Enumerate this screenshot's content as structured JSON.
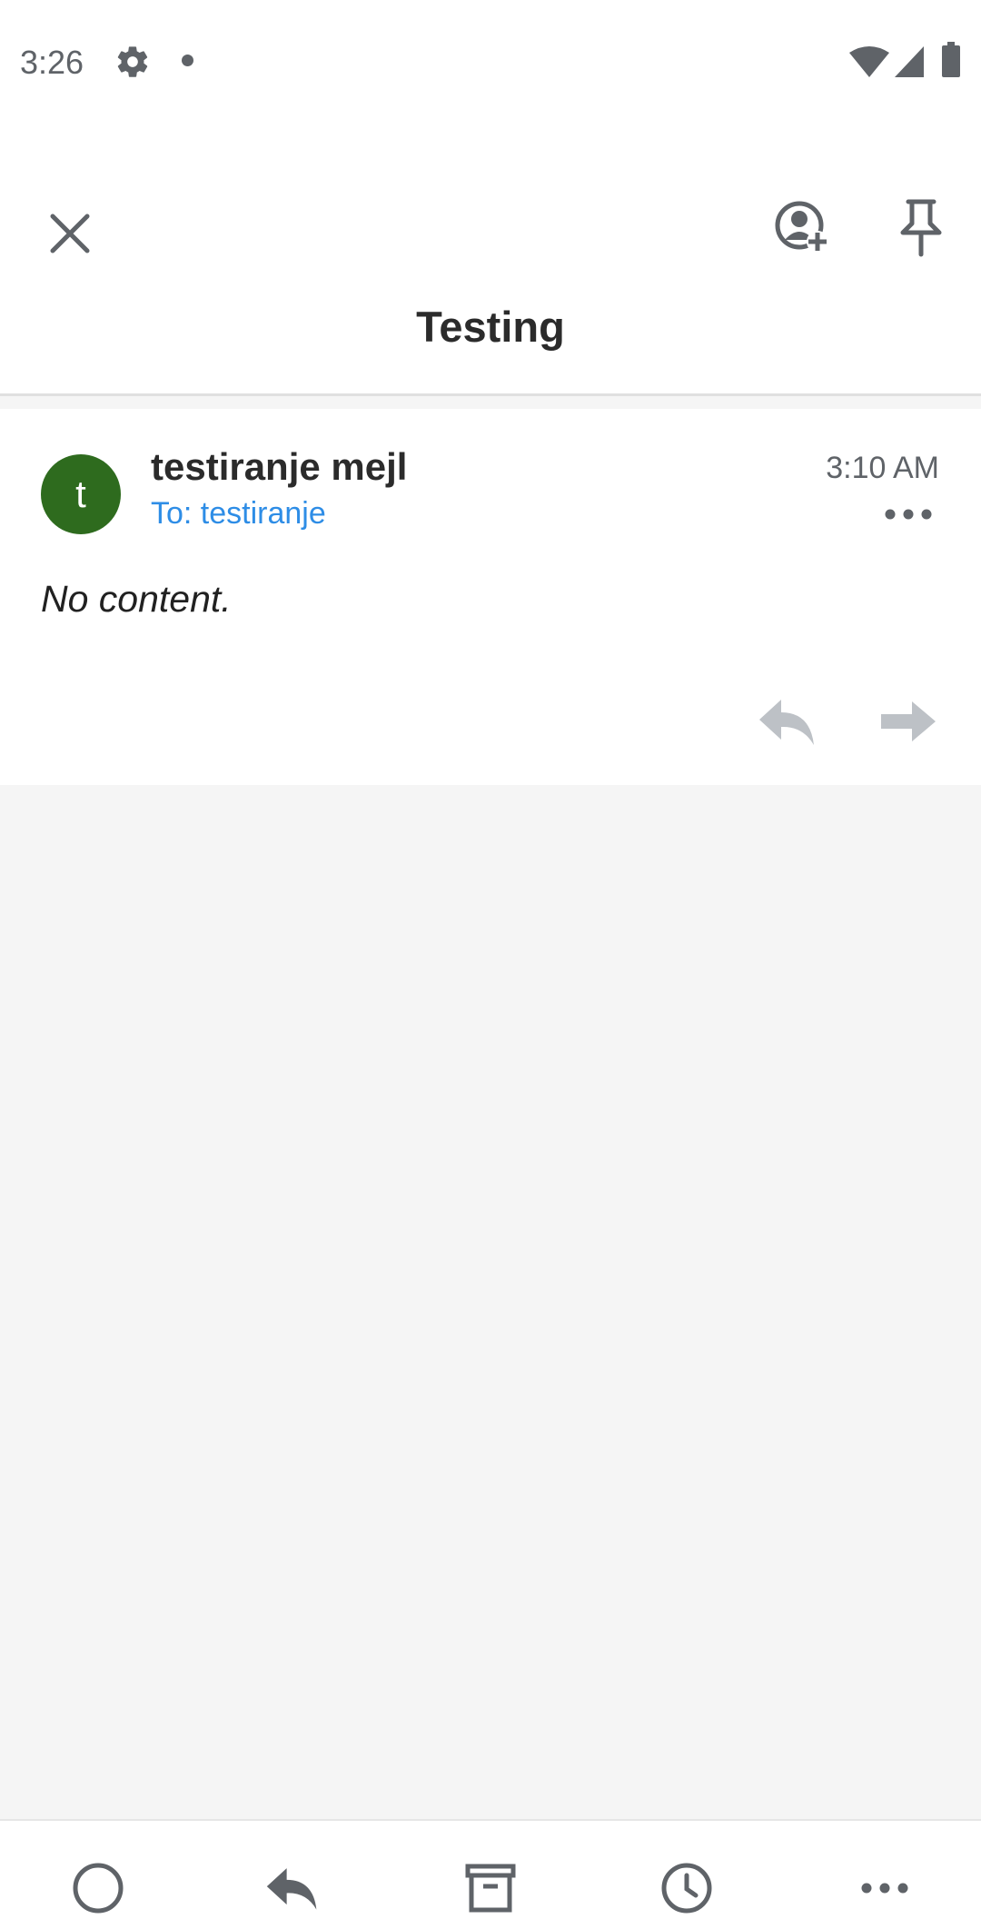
{
  "status_bar": {
    "time": "3:26",
    "icons": [
      "gear-icon",
      "notification-dot",
      "wifi-icon",
      "signal-icon",
      "battery-icon"
    ]
  },
  "app_bar": {
    "title": "Testing",
    "icons": [
      "close-icon",
      "add-contact-icon",
      "pin-icon"
    ]
  },
  "message": {
    "avatar_letter": "t",
    "avatar_color": "#2e6b1e",
    "sender": "testiranje mejl",
    "recipient": "To: testiranje",
    "time": "3:10 AM",
    "body": "No content.",
    "actions": [
      "reply-icon",
      "forward-icon",
      "more-icon"
    ]
  },
  "bottom_bar": {
    "icons": [
      "circle-icon",
      "reply-icon",
      "archive-icon",
      "clock-icon",
      "more-icon"
    ]
  },
  "colors": {
    "accent_link": "#2e8de6",
    "icon_gray": "#5f6368",
    "disabled_icon": "#bdc1c6",
    "background": "#f5f5f5"
  }
}
